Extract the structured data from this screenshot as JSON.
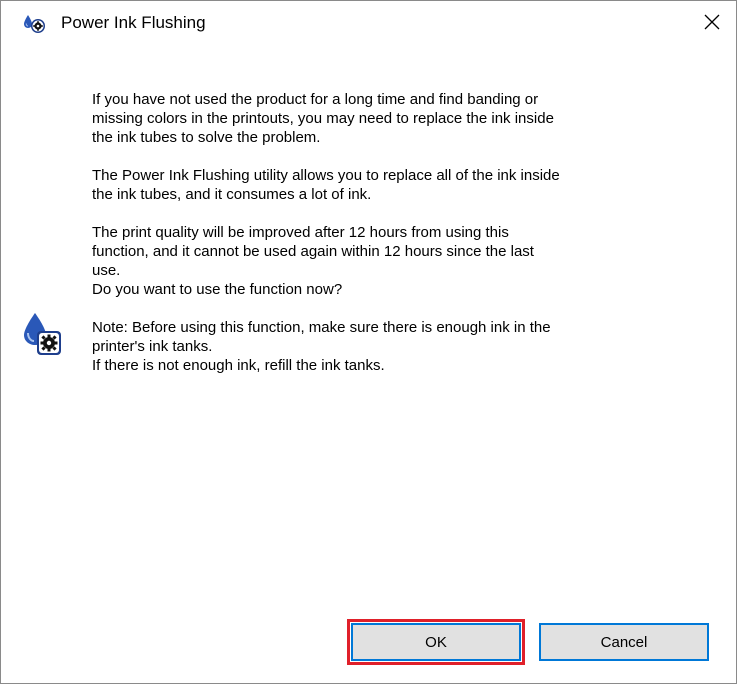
{
  "window": {
    "title": "Power Ink Flushing",
    "close_glyph": "✕"
  },
  "icons": {
    "title_icon": "ink-drop-gear-icon",
    "message_icon": "ink-drop-gear-icon",
    "close_icon": "close-icon"
  },
  "message": {
    "para1": "If you have not used the product for a long time and find banding or\nmissing colors in the printouts, you may need to replace the ink inside\nthe ink tubes to solve the problem.",
    "para2": "The Power Ink Flushing utility allows you to replace all of the ink inside\nthe ink tubes, and it consumes a lot of ink.",
    "para3": "The print quality will be improved after 12 hours from using this\nfunction, and it cannot be used again within 12 hours since the last\nuse.",
    "question": "Do you want to use the function now?",
    "note": "Note: Before using this function, make sure there is enough ink in the\nprinter's ink tanks.\nIf there is not enough ink, refill the ink tanks."
  },
  "buttons": {
    "ok_label": "OK",
    "cancel_label": "Cancel"
  },
  "colors": {
    "focus_border": "#0078d7",
    "highlight_outline": "#e0202a",
    "icon_blue": "#2a58b8"
  }
}
